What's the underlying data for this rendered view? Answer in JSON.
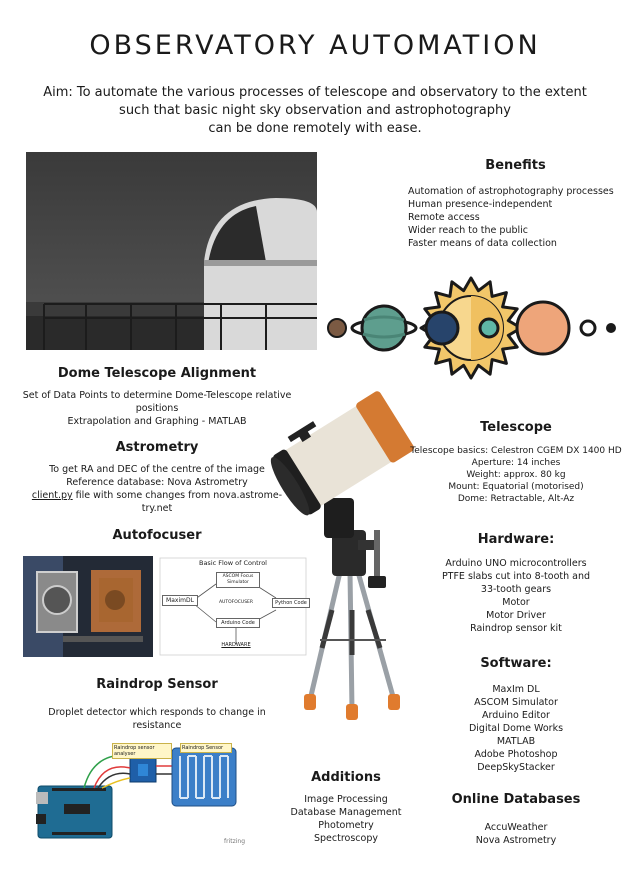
{
  "header": {
    "title": "OBSERVATORY AUTOMATION",
    "aim_lines": [
      "Aim: To automate the various processes of telescope and observatory to the extent",
      "such that basic night sky observation and astrophotography",
      "can be done remotely with ease."
    ]
  },
  "benefits": {
    "title": "Benefits",
    "items": [
      "Automation of astrophotography processes",
      "Human presence-independent",
      "Remote access",
      "Wider reach to the public",
      "Faster means of data collection"
    ]
  },
  "dome": {
    "title": "Dome Telescope Alignment",
    "lines": [
      "Set of Data Points to determine Dome-Telescope relative",
      "positions",
      "Extrapolation and Graphing - MATLAB"
    ]
  },
  "astrometry": {
    "title": "Astrometry",
    "lines": [
      "To get RA and DEC of the centre of the image",
      "Reference database: Nova Astrometry"
    ],
    "link": "client.py",
    "link_rest": " file with some changes from nova.astrome-",
    "last": "try.net"
  },
  "autofocuser": {
    "title": "Autofocuser",
    "flow_title": "Basic Flow of Control",
    "boxes": {
      "maxim": "MaximDL",
      "ascom": "ASCOM Focus Simulator",
      "auto": "AUTOFOCUSER",
      "python": "Python Code",
      "arduino": "Arduino Code",
      "hardware": "HARDWARE"
    }
  },
  "raindrop": {
    "title": "Raindrop Sensor",
    "lines": [
      "Droplet detector which responds to change in",
      "resistance"
    ],
    "label_analyser": "Raindrop sensor analyser",
    "label_sensor": "Raindrop Sensor",
    "fritzing": "fritzing"
  },
  "telescope": {
    "title": "Telescope",
    "lines": [
      "Telescope basics: Celestron CGEM DX 1400 HD",
      "Aperture: 14 inches",
      "Weight: approx. 80 kg",
      "Mount: Equatorial (motorised)",
      "Dome: Retractable, Alt-Az"
    ]
  },
  "hardware": {
    "title": "Hardware:",
    "lines": [
      "Arduino UNO microcontrollers",
      "PTFE slabs cut into 8-tooth and",
      "33-tooth gears",
      "Motor",
      "Motor Driver",
      "Raindrop sensor kit"
    ]
  },
  "software": {
    "title": "Software:",
    "lines": [
      "MaxIm DL",
      "ASCOM Simulator",
      "Arduino Editor",
      "Digital Dome Works",
      "MATLAB",
      "Adobe Photoshop",
      "DeepSkyStacker"
    ]
  },
  "additions": {
    "title": "Additions",
    "lines": [
      "Image Processing",
      "Database Management",
      "Photometry",
      "Spectroscopy"
    ]
  },
  "online": {
    "title": "Online Databases",
    "lines": [
      "AccuWeather",
      "Nova Astrometry"
    ]
  },
  "colors": {
    "planet_brown": "#7b5a43",
    "planet_teal": "#5e9e8e",
    "sun_yellow": "#f2c76a",
    "planet_navy": "#27446b",
    "planet_peach": "#eea57a"
  }
}
